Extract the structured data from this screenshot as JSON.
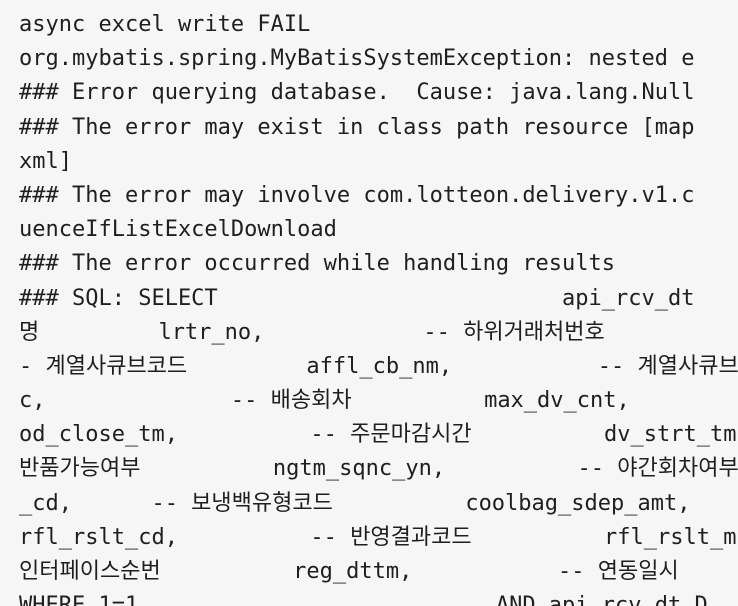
{
  "log": {
    "lines": [
      "async excel write FAIL",
      "org.mybatis.spring.MyBatisSystemException: nested e",
      "### Error querying database.  Cause: java.lang.Null",
      "### The error may exist in class path resource [map",
      "xml]",
      "### The error may involve com.lotteon.delivery.v1.c",
      "uenceIfListExcelDownload",
      "### The error occurred while handling results",
      "### SQL: SELECT                          api_rcv_dt",
      "명         lrtr_no,            -- 하위거래처번호",
      "- 계열사큐브코드         affl_cb_nm,           -- 계열사큐브",
      "c,              -- 배송회차          max_dv_cnt,",
      "od_close_tm,          -- 주문마감시간          dv_strt_tm",
      "반품가능여부          ngtm_sqnc_yn,          -- 야간회차여부",
      "_cd,      -- 보냉백유형코드          coolbag_sdep_amt,",
      "rfl_rslt_cd,          -- 반영결과코드          rfl_rslt_m",
      "인터페이스순번          reg_dttm,           -- 연동일시",
      "WHERE 1=1                           AND api_rcv_dt D"
    ]
  }
}
